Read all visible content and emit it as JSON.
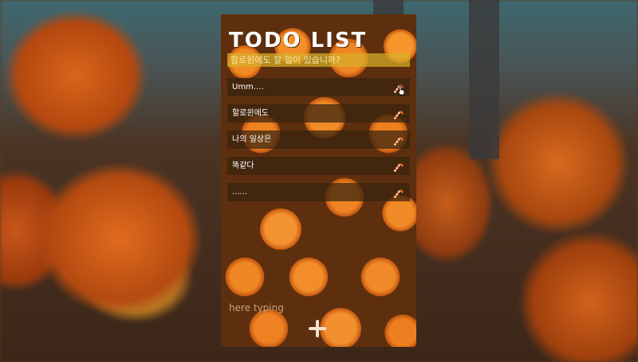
{
  "app": {
    "title": "TODO LIST",
    "subtitle": "할로윈에도 할 일이 있습니까?"
  },
  "todos": [
    {
      "text": "Umm...."
    },
    {
      "text": "할로윈에도"
    },
    {
      "text": "나의 일상은"
    },
    {
      "text": "똑같다"
    },
    {
      "text": "......"
    }
  ],
  "input": {
    "placeholder": "here typing",
    "value": ""
  },
  "icons": {
    "delete": "candy-cane-icon",
    "add": "plus-icon"
  },
  "colors": {
    "accent": "#e8702a",
    "subtitle_bg": "#d7af28",
    "item_bg": "#37230f"
  }
}
